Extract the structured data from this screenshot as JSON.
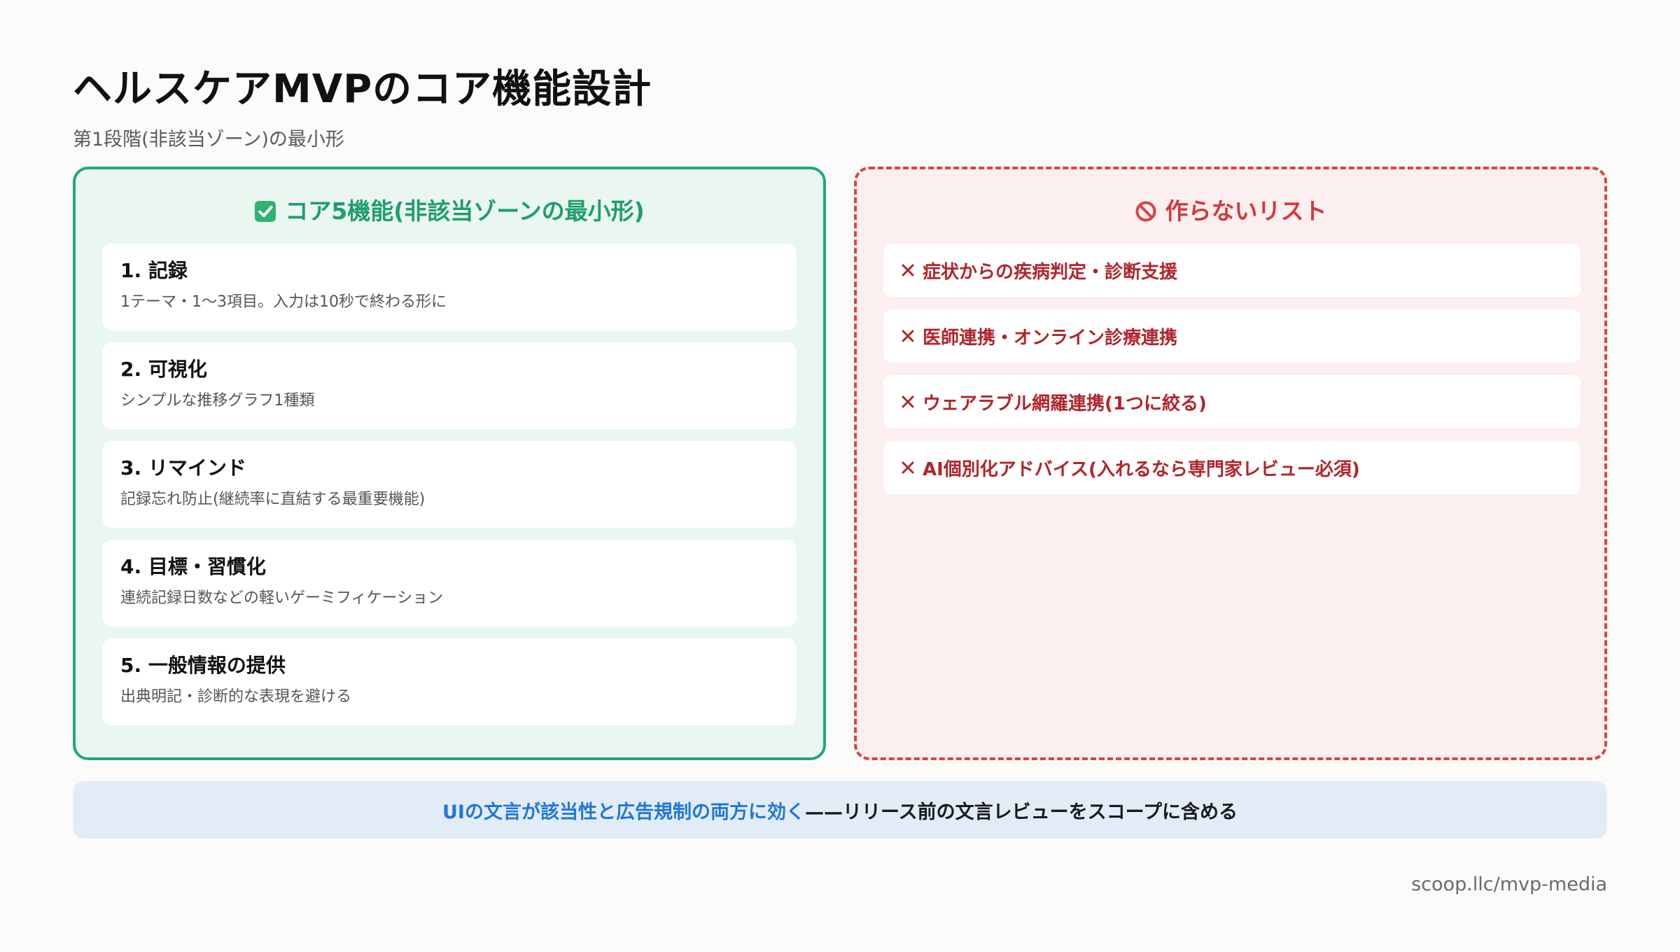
{
  "title": "ヘルスケアMVPのコア機能設計",
  "subtitle": "第1段階(非該当ゾーン)の最小形",
  "core_panel": {
    "heading": "コア5機能(非該当ゾーンの最小形)",
    "heading_icon": "check-box-icon",
    "accent_color": "#22a87a",
    "items": [
      {
        "title": "1. 記録",
        "description": "1テーマ・1〜3項目。入力は10秒で終わる形に"
      },
      {
        "title": "2. 可視化",
        "description": "シンプルな推移グラフ1種類"
      },
      {
        "title": "3. リマインド",
        "description": "記録忘れ防止(継続率に直結する最重要機能)"
      },
      {
        "title": "4. 目標・習慣化",
        "description": "連続記録日数などの軽いゲーミフィケーション"
      },
      {
        "title": "5. 一般情報の提供",
        "description": "出典明記・診断的な表現を避ける"
      }
    ]
  },
  "ng_panel": {
    "heading": "作らないリスト",
    "heading_icon": "prohibited-icon",
    "accent_color": "#d9434a",
    "items": [
      "症状からの疾病判定・診断支援",
      "医師連携・オンライン診療連携",
      "ウェアラブル網羅連携(1つに絞る)",
      "AI個別化アドバイス(入れるなら専門家レビュー必須)"
    ]
  },
  "banner": {
    "highlight": "UIの文言が該当性と広告規制の両方に効く",
    "rest": "——リリース前の文言レビューをスコープに含める"
  },
  "footer_url": "scoop.llc/mvp-media"
}
